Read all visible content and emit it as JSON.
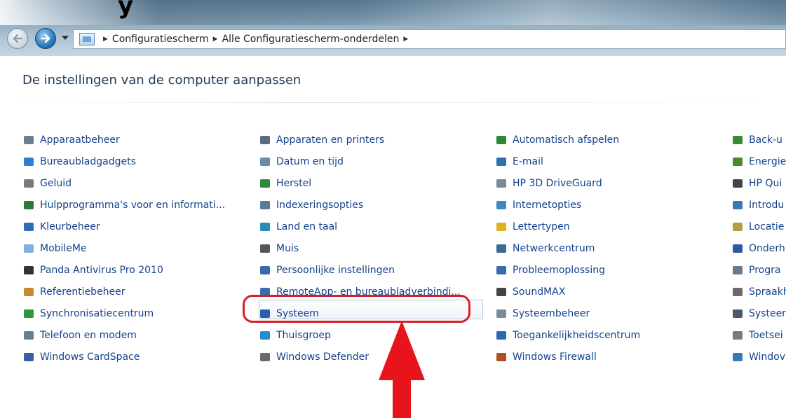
{
  "header": {
    "corner_text": "y"
  },
  "navigation": {
    "breadcrumbs": [
      "Configuratiescherm",
      "Alle Configuratiescherm-onderdelen"
    ]
  },
  "page": {
    "title": "De instellingen van de computer aanpassen"
  },
  "columns": [
    {
      "items": [
        {
          "label": "Apparaatbeheer",
          "icon": "device-manager-icon",
          "color": "#6a7e8e"
        },
        {
          "label": "Bureaubladgadgets",
          "icon": "gadgets-icon",
          "color": "#2f7fd0"
        },
        {
          "label": "Geluid",
          "icon": "speaker-icon",
          "color": "#7a7a7a"
        },
        {
          "label": "Hulpprogramma's voor en informati...",
          "icon": "performance-icon",
          "color": "#2c7a3a"
        },
        {
          "label": "Kleurbeheer",
          "icon": "color-management-icon",
          "color": "#2f6fb3"
        },
        {
          "label": "MobileMe",
          "icon": "mobileme-icon",
          "color": "#7fb0e0"
        },
        {
          "label": "Panda Antivirus Pro 2010",
          "icon": "panda-icon",
          "color": "#333333"
        },
        {
          "label": "Referentiebeheer",
          "icon": "credential-manager-icon",
          "color": "#c98a2a"
        },
        {
          "label": "Synchronisatiecentrum",
          "icon": "sync-center-icon",
          "color": "#2a9a3a"
        },
        {
          "label": "Telefoon en modem",
          "icon": "phone-modem-icon",
          "color": "#6a7e8e"
        },
        {
          "label": "Windows CardSpace",
          "icon": "cardspace-icon",
          "color": "#3a5fa8"
        }
      ]
    },
    {
      "items": [
        {
          "label": "Apparaten en printers",
          "icon": "printer-icon",
          "color": "#5a6e80"
        },
        {
          "label": "Datum en tijd",
          "icon": "clock-icon",
          "color": "#6e8aa0"
        },
        {
          "label": "Herstel",
          "icon": "recovery-icon",
          "color": "#2a8a3a"
        },
        {
          "label": "Indexeringsopties",
          "icon": "indexing-icon",
          "color": "#5a7a9a"
        },
        {
          "label": "Land en taal",
          "icon": "region-language-icon",
          "color": "#2a8ab0"
        },
        {
          "label": "Muis",
          "icon": "mouse-icon",
          "color": "#555555"
        },
        {
          "label": "Persoonlijke instellingen",
          "icon": "personalization-icon",
          "color": "#3a6ab0"
        },
        {
          "label": "RemoteApp- en bureaubladverbindi...",
          "icon": "remoteapp-icon",
          "color": "#3a6ab0"
        },
        {
          "label": "Systeem",
          "icon": "system-icon",
          "color": "#2f5fa8"
        },
        {
          "label": "Thuisgroep",
          "icon": "homegroup-icon",
          "color": "#2a8ad0"
        },
        {
          "label": "Windows Defender",
          "icon": "defender-icon",
          "color": "#6a6a6a"
        }
      ]
    },
    {
      "items": [
        {
          "label": "Automatisch afspelen",
          "icon": "autoplay-icon",
          "color": "#2a8a3a"
        },
        {
          "label": "E-mail",
          "icon": "email-icon",
          "color": "#2f6fb3"
        },
        {
          "label": "HP 3D DriveGuard",
          "icon": "drive-icon",
          "color": "#7a8a9a"
        },
        {
          "label": "Internetopties",
          "icon": "internet-options-icon",
          "color": "#3a8ac0"
        },
        {
          "label": "Lettertypen",
          "icon": "fonts-icon",
          "color": "#e0b020"
        },
        {
          "label": "Netwerkcentrum",
          "icon": "network-icon",
          "color": "#3a6a9a"
        },
        {
          "label": "Probleemoplossing",
          "icon": "troubleshooting-icon",
          "color": "#3a6ab0"
        },
        {
          "label": "SoundMAX",
          "icon": "soundmax-icon",
          "color": "#444444"
        },
        {
          "label": "Systeembeheer",
          "icon": "admin-tools-icon",
          "color": "#7a8a9a"
        },
        {
          "label": "Toegankelijkheidscentrum",
          "icon": "ease-of-access-icon",
          "color": "#2a6ab0"
        },
        {
          "label": "Windows Firewall",
          "icon": "firewall-icon",
          "color": "#b05020"
        }
      ]
    },
    {
      "items": [
        {
          "label": "Back-u",
          "icon": "backup-icon",
          "color": "#3a8a3a"
        },
        {
          "label": "Energie",
          "icon": "power-icon",
          "color": "#4a8a2a"
        },
        {
          "label": "HP Qui",
          "icon": "hp-quick-icon",
          "color": "#444444"
        },
        {
          "label": "Introdu",
          "icon": "getting-started-icon",
          "color": "#3a7ab0"
        },
        {
          "label": "Locatie",
          "icon": "location-icon",
          "color": "#b0a040"
        },
        {
          "label": "Onderh",
          "icon": "action-center-icon",
          "color": "#2a5aa0"
        },
        {
          "label": "Progra",
          "icon": "programs-icon",
          "color": "#6a7a8a"
        },
        {
          "label": "Spraakh",
          "icon": "speech-icon",
          "color": "#6a6a6a"
        },
        {
          "label": "Systeer",
          "icon": "system-tray-icon",
          "color": "#4a5a6a"
        },
        {
          "label": "Toetsei",
          "icon": "keyboard-icon",
          "color": "#7a7a7a"
        },
        {
          "label": "Windov",
          "icon": "windows-update-icon",
          "color": "#3a7ab0"
        }
      ]
    }
  ],
  "annotations": {
    "highlight_color": "#d4202a",
    "highlighted_item": "Systeem"
  }
}
